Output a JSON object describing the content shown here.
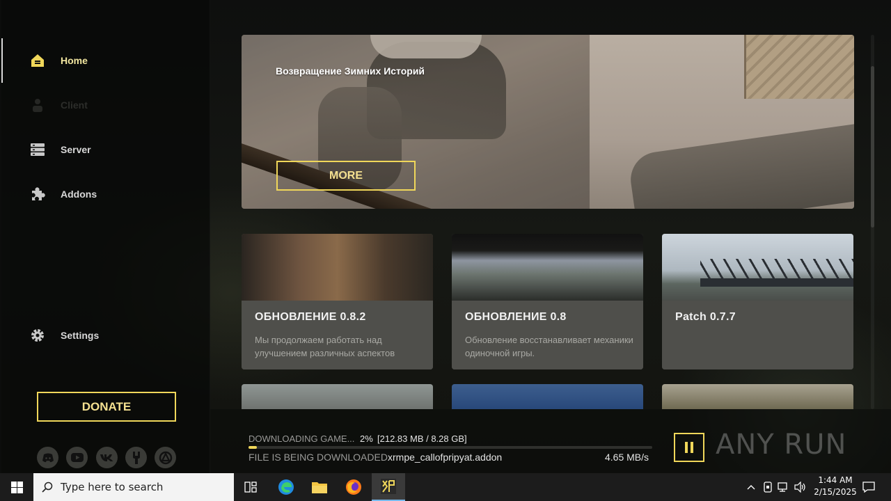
{
  "sidebar": {
    "items": [
      {
        "label": "Home",
        "icon": "home-icon",
        "state": "active"
      },
      {
        "label": "Client",
        "icon": "user-icon",
        "state": "disabled"
      },
      {
        "label": "Server",
        "icon": "server-icon",
        "state": "normal"
      },
      {
        "label": "Addons",
        "icon": "puzzle-icon",
        "state": "normal"
      }
    ],
    "settings_label": "Settings",
    "donate_label": "DONATE",
    "social_icons": [
      "discord-icon",
      "youtube-icon",
      "vk-icon",
      "tools-icon",
      "anomaly-icon"
    ]
  },
  "hero": {
    "title": "Возвращение Зимних Историй",
    "more_label": "MORE"
  },
  "news": [
    {
      "title": "ОБНОВЛЕНИЕ 0.8.2",
      "desc": "Мы продолжаем работать над улучшением различных аспектов"
    },
    {
      "title": "ОБНОВЛЕНИЕ 0.8",
      "desc": "Обновление восстанавливает механики одиночной игры."
    },
    {
      "title": "Patch 0.7.7",
      "desc": ""
    }
  ],
  "download": {
    "status_label": "DOWNLOADING GAME...",
    "percent_text": "2%",
    "size_text": "[212.83 MB / 8.28 GB]",
    "progress": 0.02,
    "file_label": "FILE IS BEING DOWNLOADED",
    "file_name": "xrmpe_callofpripyat.addon",
    "speed": "4.65 MB/s"
  },
  "watermark": "ANY RUN",
  "taskbar": {
    "search_placeholder": "Type here to search",
    "time": "1:44 AM",
    "date": "2/15/2025",
    "apps": [
      "task-view-icon",
      "edge-icon",
      "file-explorer-icon",
      "firefox-icon",
      "xrmpe-launcher-icon"
    ]
  },
  "colors": {
    "accent": "#f0d75a",
    "accent_text": "#f4e090",
    "active_nav": "#f2e6a0"
  }
}
